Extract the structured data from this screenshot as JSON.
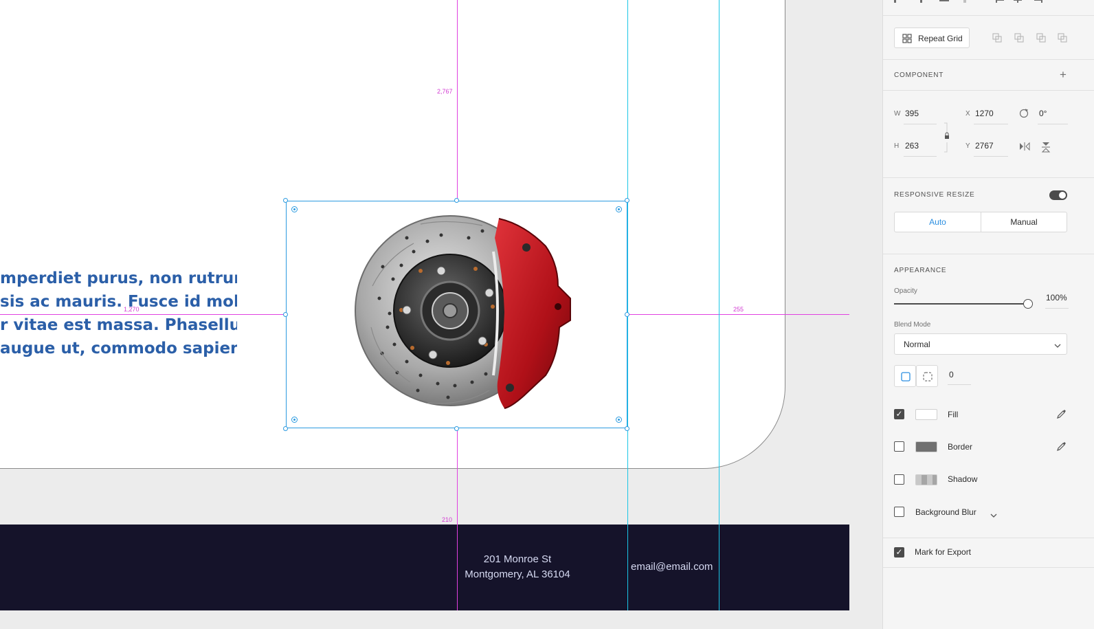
{
  "canvas": {
    "body_text_lines": [
      "mperdiet purus, non rutrum",
      "sis ac mauris. Fusce id mollis",
      "r vitae est massa. Phasellus",
      "augue ut, commodo sapien."
    ],
    "guides": {
      "top_distance": "2,767",
      "left_distance": "1,270",
      "right_distance": "255",
      "bottom_distance": "210"
    },
    "footer": {
      "address_line1": "201 Monroe St",
      "address_line2": "Montgomery, AL 36104",
      "email": "email@email.com"
    }
  },
  "panel": {
    "repeat_grid_label": "Repeat Grid",
    "component": {
      "title": "COMPONENT",
      "add_icon": "plus-icon"
    },
    "transform": {
      "w_label": "W",
      "w_value": "395",
      "h_label": "H",
      "h_value": "263",
      "x_label": "X",
      "x_value": "1270",
      "y_label": "Y",
      "y_value": "2767",
      "rotation_value": "0°"
    },
    "responsive_resize": {
      "title": "RESPONSIVE RESIZE",
      "enabled": true,
      "options": [
        "Auto",
        "Manual"
      ],
      "selected": "Auto"
    },
    "appearance": {
      "title": "APPEARANCE",
      "opacity_label": "Opacity",
      "opacity_value": "100%",
      "blend_label": "Blend Mode",
      "blend_value": "Normal",
      "corner_radius": "0",
      "fill_label": "Fill",
      "fill_checked": true,
      "fill_color": "#ffffff",
      "border_label": "Border",
      "border_checked": false,
      "border_color": "#707070",
      "shadow_label": "Shadow",
      "shadow_checked": false,
      "blur_label": "Background Blur",
      "blur_checked": false
    },
    "export": {
      "label": "Mark for Export",
      "checked": true
    }
  },
  "colors": {
    "accent": "#2a9ae0",
    "guide_magenta": "#e040e0",
    "guide_cyan": "#1ac6e6",
    "footer_bg": "#15132a",
    "text_blue": "#2b5fa8",
    "caliper_red": "#c8151d"
  }
}
